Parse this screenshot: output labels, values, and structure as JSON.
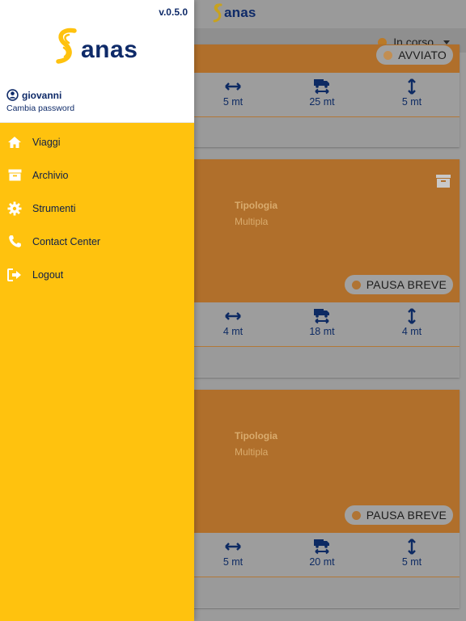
{
  "drawer": {
    "version": "v.0.5.0",
    "brand": "anas",
    "user": {
      "name": "giovanni",
      "change_password": "Cambia password"
    },
    "menu": [
      {
        "label": "Viaggi",
        "icon": "home-icon"
      },
      {
        "label": "Archivio",
        "icon": "archive-icon"
      },
      {
        "label": "Strumenti",
        "icon": "gear-icon"
      },
      {
        "label": "Contact Center",
        "icon": "phone-icon"
      },
      {
        "label": "Logout",
        "icon": "logout-icon"
      }
    ]
  },
  "header": {
    "brand": "anas"
  },
  "filter": {
    "label": "In corso"
  },
  "cards": [
    {
      "status": "AVVIATO",
      "metrics": [
        {
          "icon": "width-arrows-icon",
          "value": "5 mt"
        },
        {
          "icon": "truck-length-icon",
          "value": "25 mt"
        },
        {
          "icon": "height-arrows-icon",
          "value": "5 mt"
        }
      ]
    },
    {
      "tipologia_label": "Tipologia",
      "tipologia_value": "Multipla",
      "status": "PAUSA BREVE",
      "metrics": [
        {
          "icon": "width-arrows-icon",
          "value": "4 mt"
        },
        {
          "icon": "truck-length-icon",
          "value": "18 mt"
        },
        {
          "icon": "height-arrows-icon",
          "value": "4 mt"
        }
      ]
    },
    {
      "tipologia_label": "Tipologia",
      "tipologia_value": "Multipla",
      "status": "PAUSA BREVE",
      "metrics": [
        {
          "icon": "width-arrows-icon",
          "value": "5 mt"
        },
        {
          "icon": "truck-length-icon",
          "value": "20 mt"
        },
        {
          "icon": "height-arrows-icon",
          "value": "5 mt"
        }
      ]
    }
  ],
  "colors": {
    "drawer_bg": "#ffc20e",
    "brand_navy": "#0e2a68",
    "card_header": "#b06f2b",
    "status_dot": "#b07434"
  }
}
